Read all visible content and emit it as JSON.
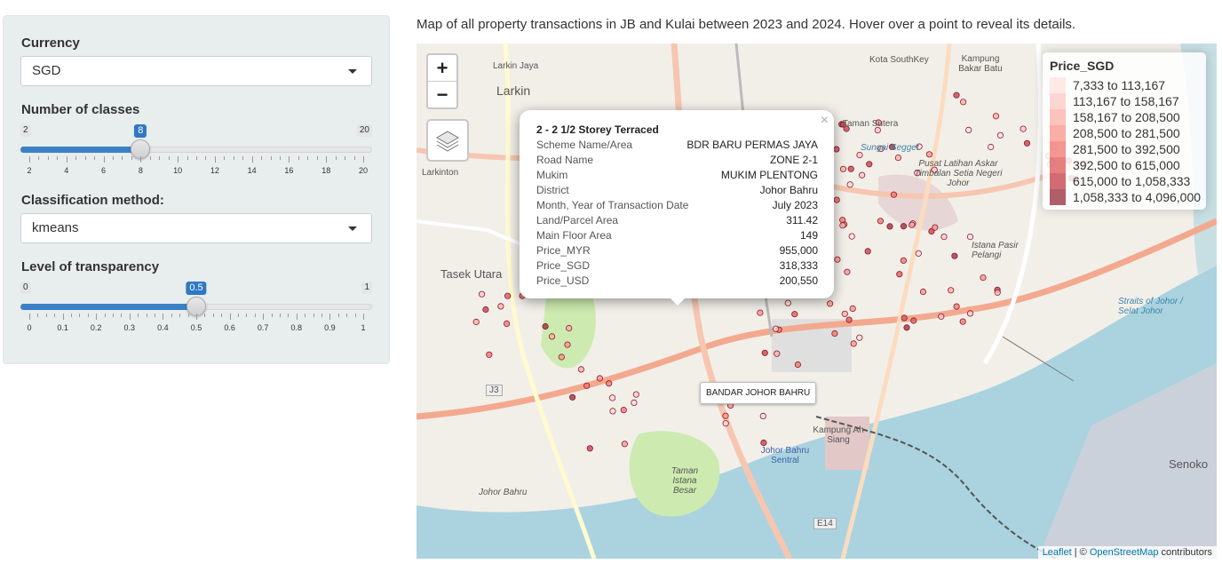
{
  "sidebar": {
    "currency": {
      "label": "Currency",
      "selected": "SGD"
    },
    "num_classes": {
      "label": "Number of classes",
      "min": "2",
      "max": "20",
      "value": "8",
      "value_num": 8,
      "ticks": [
        "2",
        "4",
        "6",
        "8",
        "10",
        "12",
        "14",
        "16",
        "18",
        "20"
      ]
    },
    "class_method": {
      "label": "Classification method:",
      "selected": "kmeans"
    },
    "transparency": {
      "label": "Level of transparency",
      "min": "0",
      "max": "1",
      "value": "0.5",
      "value_num": 0.5,
      "ticks": [
        "0",
        "0.1",
        "0.2",
        "0.3",
        "0.4",
        "0.5",
        "0.6",
        "0.7",
        "0.8",
        "0.9",
        "1"
      ]
    }
  },
  "main": {
    "description": "Map of all property transactions in JB and Kulai between 2023 and 2024. Hover over a point to reveal its details."
  },
  "map": {
    "zoom_in": "+",
    "zoom_out": "−",
    "legend": {
      "title": "Price_SGD",
      "items": [
        {
          "label": "7,333 to 113,167",
          "color": "#fde0dd"
        },
        {
          "label": "113,167 to 158,167",
          "color": "#fcc5c0"
        },
        {
          "label": "158,167 to 208,500",
          "color": "#fbaaa2"
        },
        {
          "label": "208,500 to 281,500",
          "color": "#f88b82"
        },
        {
          "label": "281,500 to 392,500",
          "color": "#ef6b63"
        },
        {
          "label": "392,500 to 615,000",
          "color": "#d94b4b"
        },
        {
          "label": "615,000 to 1,058,333",
          "color": "#bd2d3a"
        },
        {
          "label": "1,058,333 to 4,096,000",
          "color": "#8f1a2b"
        }
      ]
    },
    "popup": {
      "title": "2 - 2 1/2 Storey Terraced",
      "close": "×",
      "rows": [
        {
          "key": "Scheme Name/Area",
          "value": "BDR BARU PERMAS JAYA"
        },
        {
          "key": "Road Name",
          "value": "ZONE 2-1"
        },
        {
          "key": "Mukim",
          "value": "MUKIM PLENTONG"
        },
        {
          "key": "District",
          "value": "Johor Bahru"
        },
        {
          "key": "Month, Year of Transaction Date",
          "value": "July 2023"
        },
        {
          "key": "Land/Parcel Area",
          "value": "311.42"
        },
        {
          "key": "Main Floor Area",
          "value": "149"
        },
        {
          "key": "Price_MYR",
          "value": "955,000"
        },
        {
          "key": "Price_SGD",
          "value": "318,333"
        },
        {
          "key": "Price_USD",
          "value": "200,550"
        }
      ]
    },
    "label_tooltip": "BANDAR JOHOR BAHRU",
    "attribution": {
      "leaflet": "Leaflet",
      "sep": " | © ",
      "osm": "OpenStreetMap",
      "suffix": " contributors"
    },
    "places": [
      "Larkin Jaya",
      "Larkin",
      "Larkinton",
      "Tasek Utara",
      "Kota SouthKey",
      "Kampung Bakar Batu",
      "Taman Sutera",
      "Sungai Segget",
      "Pusat Latihan Askar Timbalan Setia Negeri Johor",
      "Istana Pasir Pelangi",
      "Straits of Johor / Selat Johor",
      "Kampung Ah Siang",
      "Johor Bahru Sentral",
      "Taman Istana Besar",
      "Johor Bahru",
      "Senoko",
      "E14",
      "J3"
    ],
    "colors": {
      "water": "#aad3df",
      "land": "#f2efe9",
      "green": "#cdebb0",
      "road": "#f7c6b0"
    }
  }
}
